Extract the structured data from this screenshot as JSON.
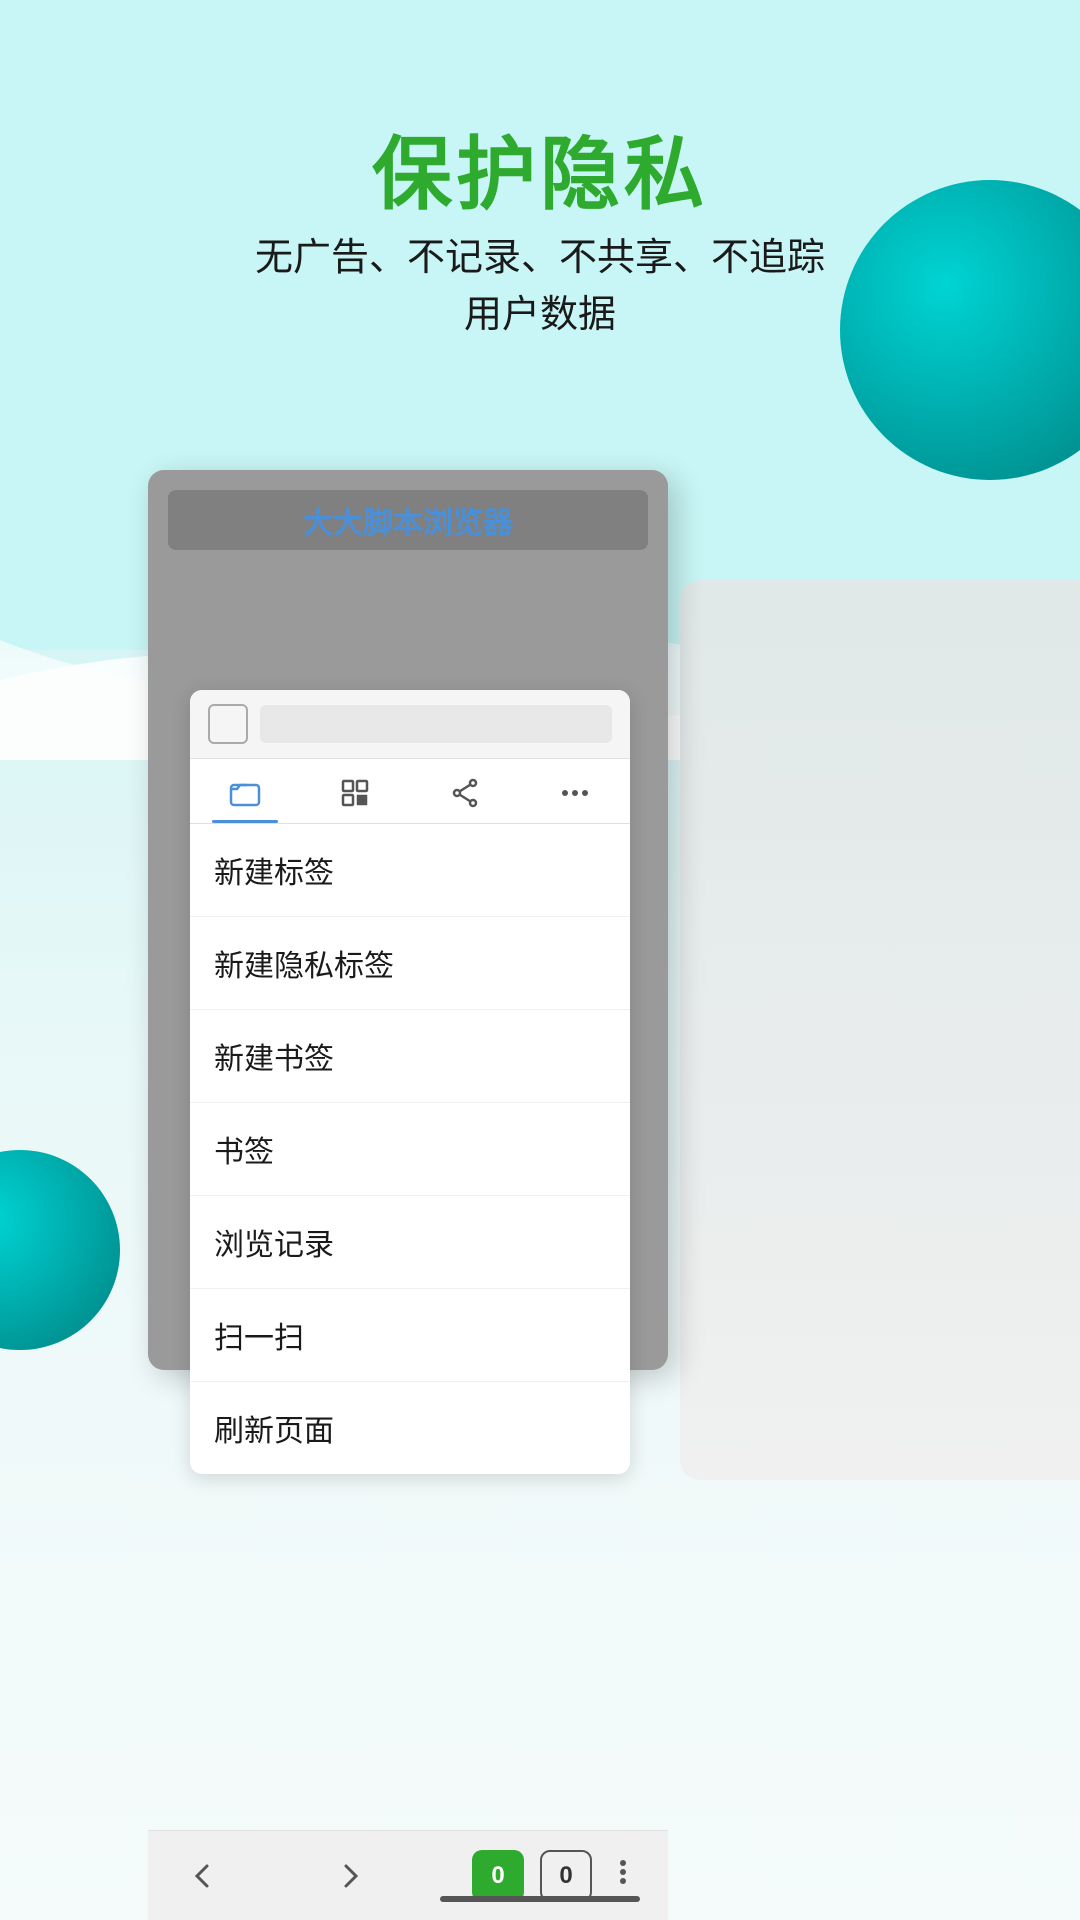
{
  "page": {
    "background_color": "#c8f5f5"
  },
  "header": {
    "title": "保护隐私",
    "subtitle_line1": "无广告、不记录、不共享、不追踪",
    "subtitle_line2": "用户数据"
  },
  "browser": {
    "title": "大大脚本浏览器"
  },
  "popup": {
    "address_bar_placeholder": "",
    "tabs": [
      {
        "icon": "folder",
        "label": "标签",
        "active": true
      },
      {
        "icon": "scan",
        "label": "扫描",
        "active": false
      },
      {
        "icon": "share",
        "label": "分享",
        "active": false
      },
      {
        "icon": "more",
        "label": "更多",
        "active": false
      }
    ],
    "menu_items": [
      {
        "label": "新建标签"
      },
      {
        "label": "新建隐私标签"
      },
      {
        "label": "新建书签"
      },
      {
        "label": "书签"
      },
      {
        "label": "浏览记录"
      },
      {
        "label": "扫一扫"
      },
      {
        "label": "刷新页面"
      }
    ]
  },
  "bottom_nav": {
    "back_label": "<",
    "forward_label": ">",
    "tab_count_green": "0",
    "tab_count_outline": "0"
  }
}
